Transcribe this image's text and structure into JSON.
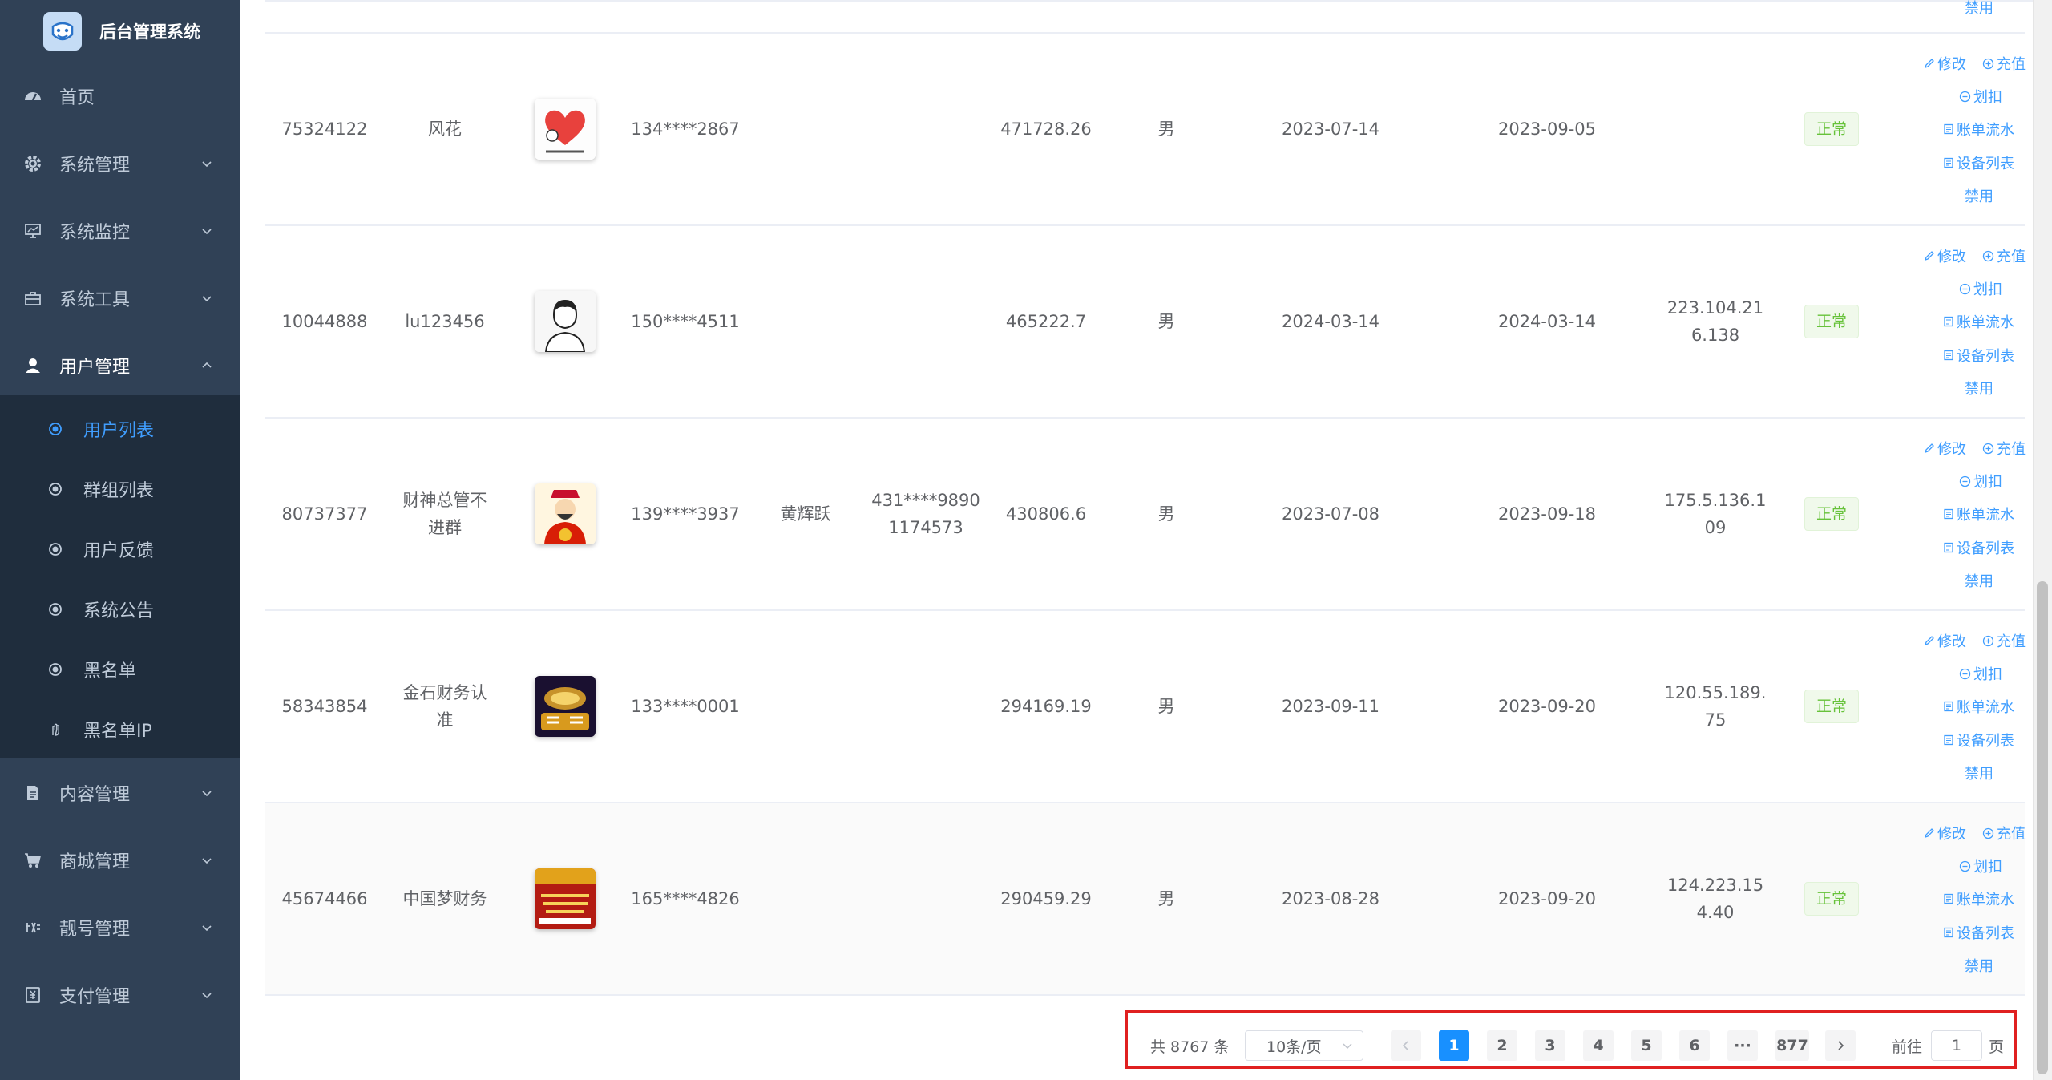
{
  "app": {
    "title": "后台管理系统"
  },
  "sidebar": {
    "items": [
      {
        "label": "首页",
        "icon": "dashboard-icon"
      },
      {
        "label": "系统管理",
        "icon": "gear-icon"
      },
      {
        "label": "系统监控",
        "icon": "monitor-icon"
      },
      {
        "label": "系统工具",
        "icon": "toolbox-icon"
      },
      {
        "label": "用户管理",
        "icon": "user-icon"
      },
      {
        "label": "内容管理",
        "icon": "document-icon"
      },
      {
        "label": "商城管理",
        "icon": "cart-icon"
      },
      {
        "label": "靓号管理",
        "icon": "number-icon"
      },
      {
        "label": "支付管理",
        "icon": "payment-icon"
      }
    ],
    "submenu": [
      {
        "label": "用户列表",
        "active": true
      },
      {
        "label": "群组列表"
      },
      {
        "label": "用户反馈"
      },
      {
        "label": "系统公告"
      },
      {
        "label": "黑名单"
      },
      {
        "label": "黑名单IP"
      }
    ]
  },
  "table": {
    "partial_top_op": "禁用",
    "ops": {
      "edit": "修改",
      "recharge": "充值",
      "deduct": "划扣",
      "bills": "账单流水",
      "devices": "设备列表",
      "disable": "禁用"
    },
    "rows": [
      {
        "id": "75324122",
        "nickname": "风花",
        "avatar": "heart-avatar",
        "phone": "134****2867",
        "realname": "",
        "idcard": "",
        "balance": "471728.26",
        "gender": "男",
        "created": "2023-07-14",
        "last_login": "2023-09-05",
        "ip": "",
        "status": "正常"
      },
      {
        "id": "10044888",
        "nickname": "lu123456",
        "avatar": "man-avatar",
        "phone": "150****4511",
        "realname": "",
        "idcard": "",
        "balance": "465222.7",
        "gender": "男",
        "created": "2024-03-14",
        "last_login": "2024-03-14",
        "ip": "223.104.21\n6.138",
        "status": "正常"
      },
      {
        "id": "80737377",
        "nickname": "财神总管不\n进群",
        "avatar": "fortune-god-avatar",
        "phone": "139****3937",
        "realname": "黄辉跃",
        "idcard": "431****9890\n1174573",
        "balance": "430806.6",
        "gender": "男",
        "created": "2023-07-08",
        "last_login": "2023-09-18",
        "ip": "175.5.136.1\n09",
        "status": "正常"
      },
      {
        "id": "58343854",
        "nickname": "金石财务认\n准",
        "avatar": "finance-avatar",
        "phone": "133****0001",
        "realname": "",
        "idcard": "",
        "balance": "294169.19",
        "gender": "男",
        "created": "2023-09-11",
        "last_login": "2023-09-20",
        "ip": "120.55.189.\n75",
        "status": "正常"
      },
      {
        "id": "45674466",
        "nickname": "中国梦财务",
        "avatar": "china-dream-avatar",
        "phone": "165****4826",
        "realname": "",
        "idcard": "",
        "balance": "290459.29",
        "gender": "男",
        "created": "2023-08-28",
        "last_login": "2023-09-20",
        "ip": "124.223.15\n4.40",
        "status": "正常"
      }
    ]
  },
  "pagination": {
    "total": "共 8767 条",
    "page_size": "10条/页",
    "pages": [
      "1",
      "2",
      "3",
      "4",
      "5",
      "6",
      "···",
      "877"
    ],
    "current": "1",
    "goto_prefix": "前往",
    "goto_value": "1",
    "goto_suffix": "页"
  },
  "colors": {
    "sidebar_bg": "#304156",
    "submenu_bg": "#1f2d3d",
    "accent": "#409eff",
    "status_green": "#67c23a",
    "highlight_box": "#e02020"
  }
}
